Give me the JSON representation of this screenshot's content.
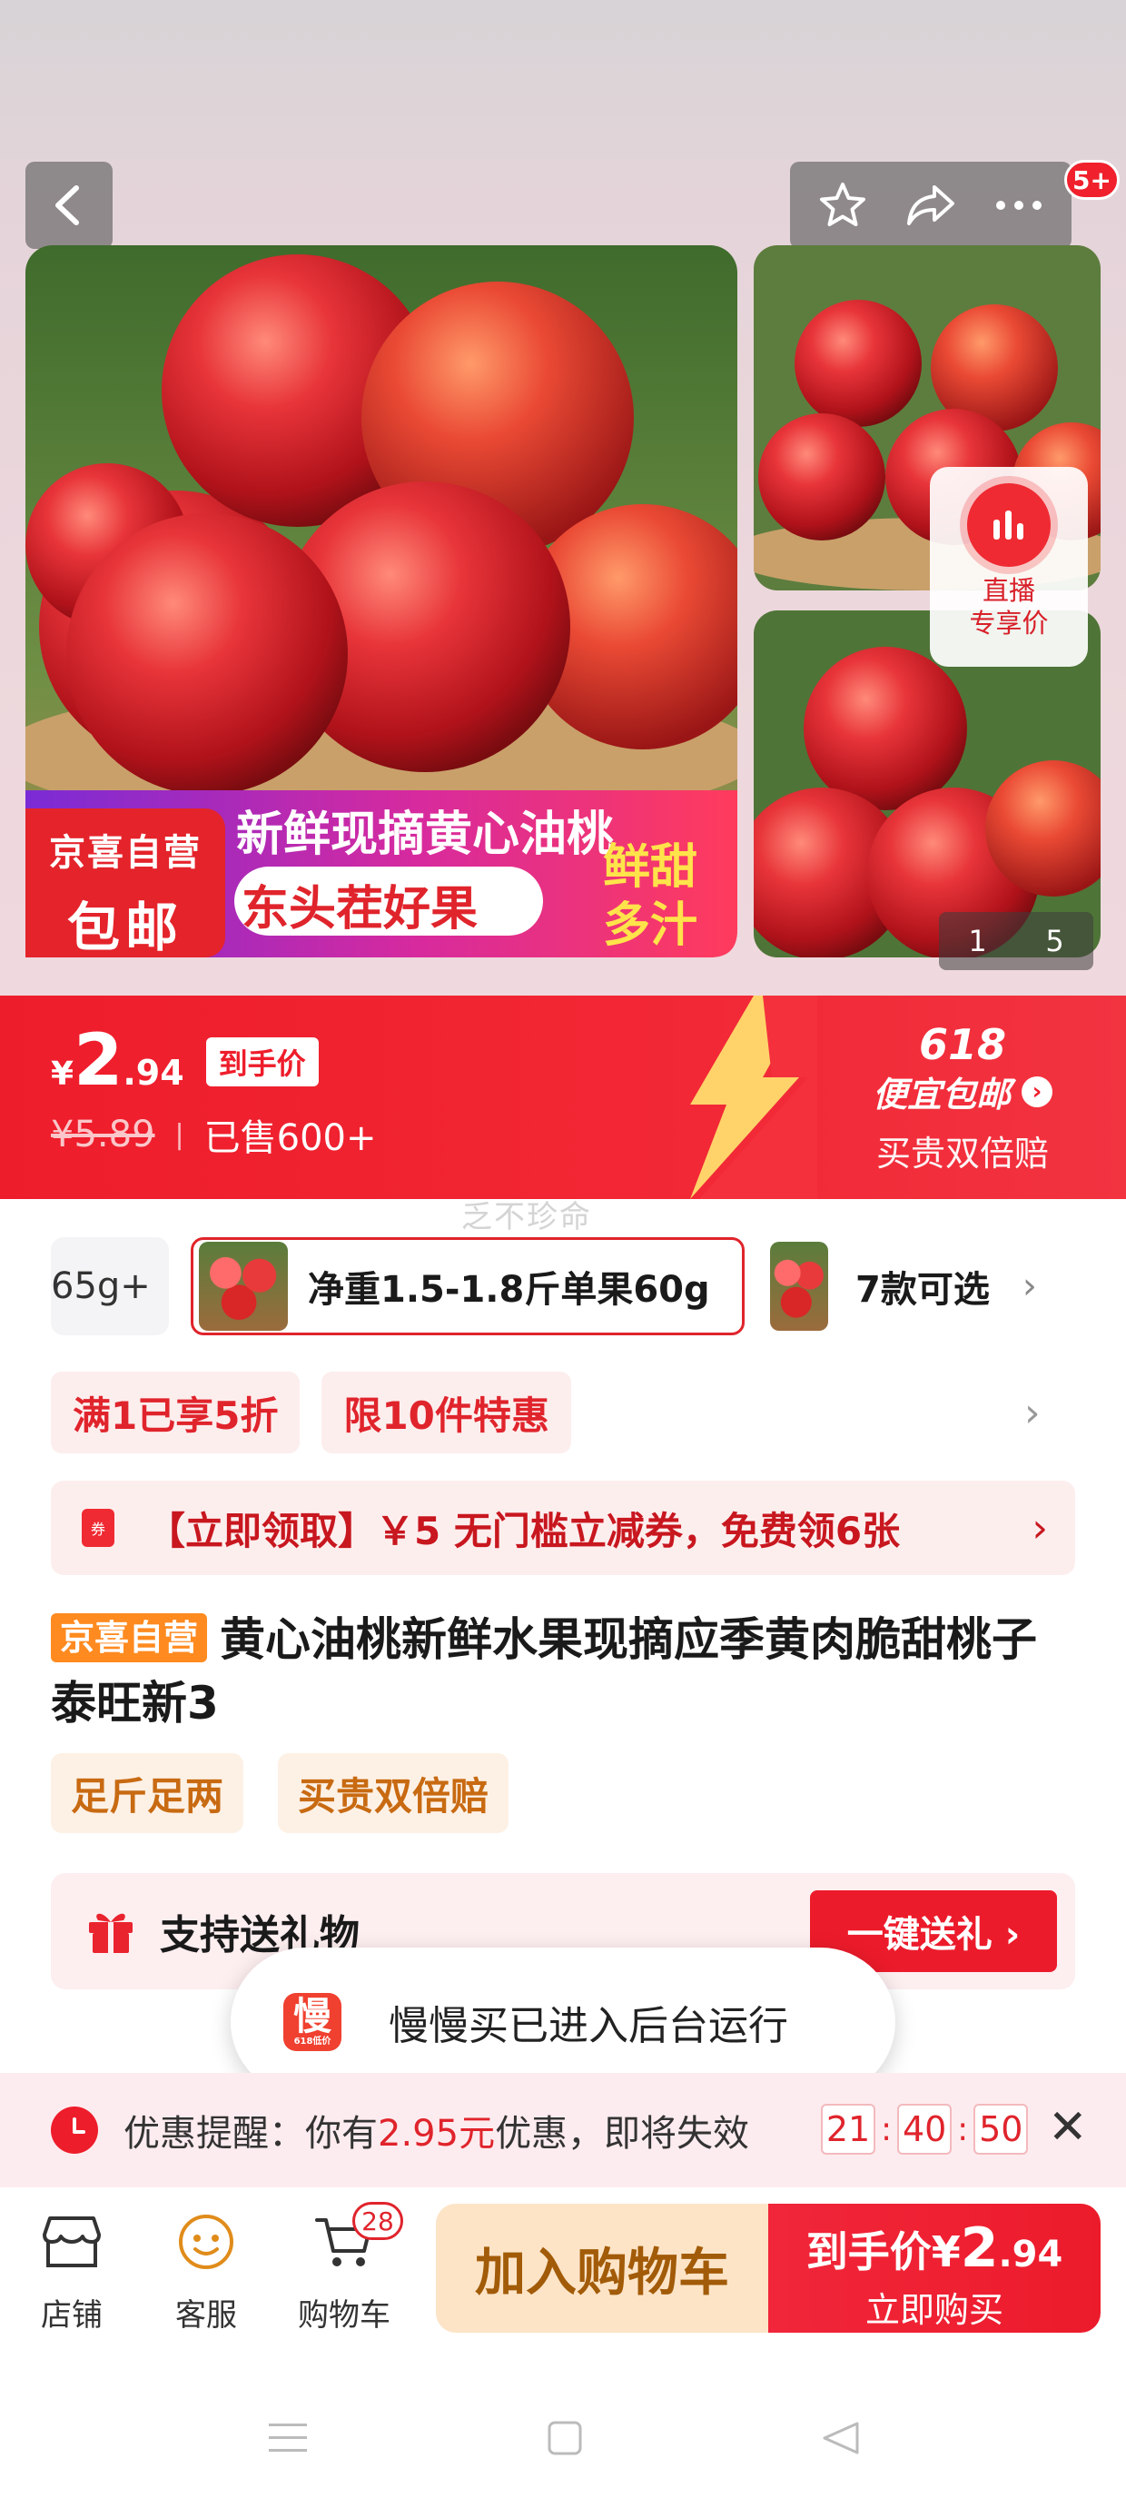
{
  "top_actions": {
    "badge": "5+"
  },
  "hero": {
    "promo_text_1": "新鲜现摘黄心油桃",
    "promo_text_2": "东头茬好果",
    "promo_text_3": "鲜甜",
    "promo_text_4": "多汁",
    "badge_line1": "京喜自营",
    "badge_line2": "包邮",
    "live_line1": "直播",
    "live_line2": "专享价",
    "pager_current": "1",
    "pager_total": "5"
  },
  "price": {
    "currency": "¥",
    "integer": "2",
    "decimal": ".94",
    "final_tag": "到手价",
    "original": "¥5.89",
    "separator": "|",
    "sold": "已售600+",
    "event": "618",
    "event_title": "便宜包邮",
    "event_sub": "买贵双倍赔"
  },
  "watermark": "乏不珍命",
  "sku": {
    "prev": "65g+",
    "selected": "净重1.5-1.8斤单果60g",
    "more": "7款可选"
  },
  "chips": [
    "满1已享5折",
    "限10件特惠"
  ],
  "coupon": {
    "icon_text": "券",
    "text": "【立即领取】￥5 无门槛立减券，免费领6张"
  },
  "product": {
    "tag": "京喜自营",
    "title": "黄心油桃新鲜水果现摘应季黄肉脆甜桃子泰旺新3",
    "features": [
      "足斤足两",
      "买贵双倍赔"
    ]
  },
  "gift": {
    "text": "支持送礼物",
    "button": "一键送礼 ›"
  },
  "toast": {
    "icon_char": "慢",
    "icon_sub": "618低价",
    "text": "慢慢买已进入后台运行"
  },
  "reminder": {
    "prefix": "优惠提醒：你有",
    "amount": "2.95元",
    "suffix": "优惠，即将失效",
    "hh": "21",
    "mm": "40",
    "ss": "50"
  },
  "bottom_nav": {
    "shop": "店铺",
    "service": "客服",
    "cart": "购物车",
    "cart_count": "28",
    "add_to_cart": "加入购物车",
    "buy_prefix": "到手价¥",
    "buy_int": "2",
    "buy_dec": ".94",
    "buy_now": "立即购买"
  },
  "colors": {
    "accent": "#ee1d2b",
    "orange_tag": "#ff8a1f",
    "cart_btn": "#fde4c7"
  }
}
